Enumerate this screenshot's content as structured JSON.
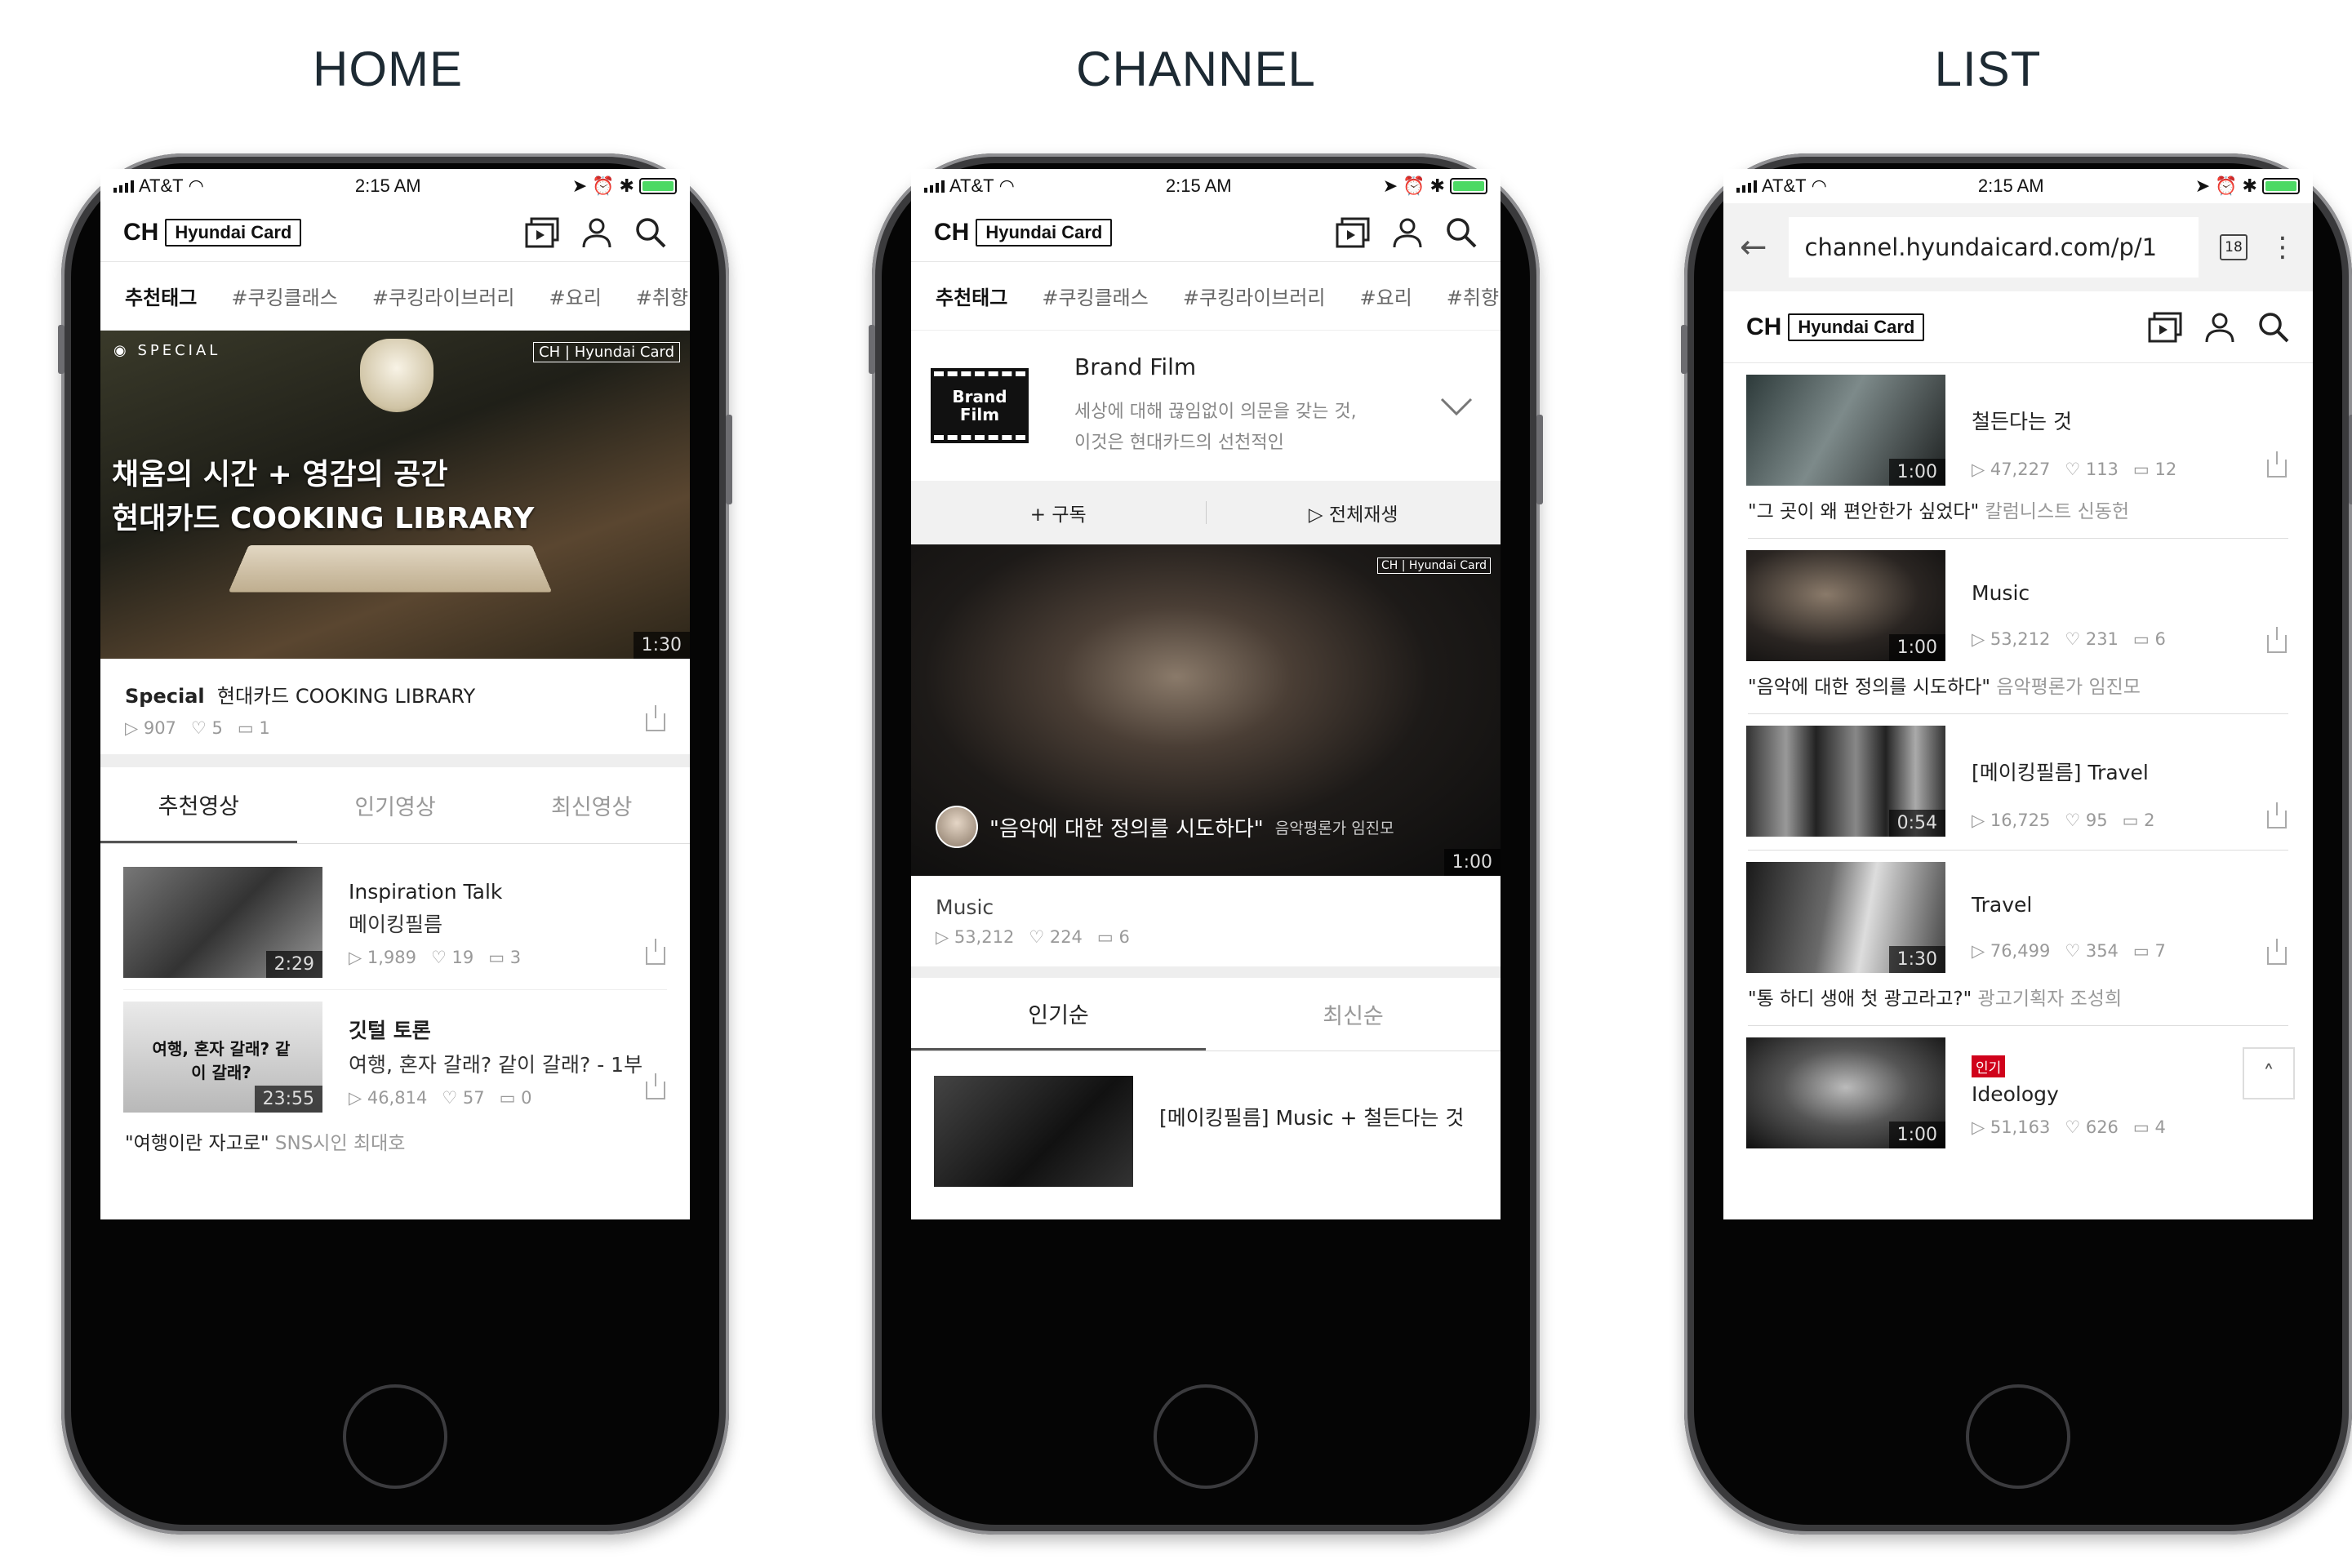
{
  "titles": {
    "home": "HOME",
    "channel": "CHANNEL",
    "list": "LIST"
  },
  "status": {
    "carrier": "AT&T",
    "time": "2:15 AM"
  },
  "logo": {
    "ch": "CH",
    "brand": "Hyundai Card"
  },
  "tags": [
    "추천태그",
    "#쿠킹클래스",
    "#쿠킹라이브러리",
    "#요리",
    "#취향ㅂ"
  ],
  "home": {
    "hero": {
      "special": "SPECIAL",
      "corner_logo": "CH | Hyundai Card",
      "line1": "채움의 시간 + 영감의 공간",
      "line2": "현대카드 COOKING LIBRARY",
      "duration": "1:30"
    },
    "featured": {
      "label": "Special",
      "title": "현대카드 COOKING LIBRARY",
      "plays": "907",
      "likes": "5",
      "comments": "1"
    },
    "tabs": [
      "추천영상",
      "인기영상",
      "최신영상"
    ],
    "items": [
      {
        "title": "Inspiration Talk",
        "subtitle": "메이킹필름",
        "duration": "2:29",
        "plays": "1,989",
        "likes": "19",
        "comments": "3"
      },
      {
        "title": "깃털 토론",
        "subtitle": "여행, 혼자 갈래? 같이 갈래? - 1부",
        "duration": "23:55",
        "plays": "46,814",
        "likes": "57",
        "comments": "0",
        "thumb_text": "여행, 혼자 갈래? 같이 갈래?"
      }
    ],
    "quote": {
      "text": "\"여행이란 자고로\"",
      "author": "SNS시인 최대호"
    }
  },
  "channel": {
    "brand_icon": "Brand Film",
    "brand_title": "Brand Film",
    "brand_desc": "세상에 대해 끊임없이 의문을 갖는 것, 이것은 현대카드의 선천적인",
    "subscribe": "+ 구독",
    "playall": "▷ 전체재생",
    "video": {
      "quote": "\"음악에 대한 정의를 시도하다\"",
      "author": "음악평론가 임진모",
      "duration": "1:00",
      "corner_logo": "CH | Hyundai Card"
    },
    "info": {
      "title": "Music",
      "plays": "53,212",
      "likes": "224",
      "comments": "6"
    },
    "tabs": [
      "인기순",
      "최신순"
    ],
    "item": {
      "title": "[메이킹필름] Music + 철든다는 것"
    }
  },
  "list": {
    "url": "channel.hyundaicard.com/p/1",
    "tab_count": "18",
    "items": [
      {
        "title": "철든다는 것",
        "duration": "1:00",
        "plays": "47,227",
        "likes": "113",
        "comments": "12",
        "quote": "\"그 곳이 왜 편안한가 싶었다\"",
        "author": "칼럼니스트 신동헌"
      },
      {
        "title": "Music",
        "duration": "1:00",
        "plays": "53,212",
        "likes": "231",
        "comments": "6",
        "quote": "\"음악에 대한 정의를 시도하다\"",
        "author": "음악평론가 임진모"
      },
      {
        "title": "[메이킹필름] Travel",
        "duration": "0:54",
        "plays": "16,725",
        "likes": "95",
        "comments": "2",
        "quote": "",
        "author": ""
      },
      {
        "title": "Travel",
        "duration": "1:30",
        "plays": "76,499",
        "likes": "354",
        "comments": "7",
        "quote": "\"통 하디 생애 첫 광고라고?\"",
        "author": "광고기획자 조성희"
      },
      {
        "title": "Ideology",
        "badge": "인기",
        "duration": "1:00",
        "plays": "51,163",
        "likes": "626",
        "comments": "4",
        "quote": "",
        "author": ""
      }
    ]
  },
  "colors": {
    "accent_red": "#d0021b",
    "battery": "#4cd964"
  }
}
